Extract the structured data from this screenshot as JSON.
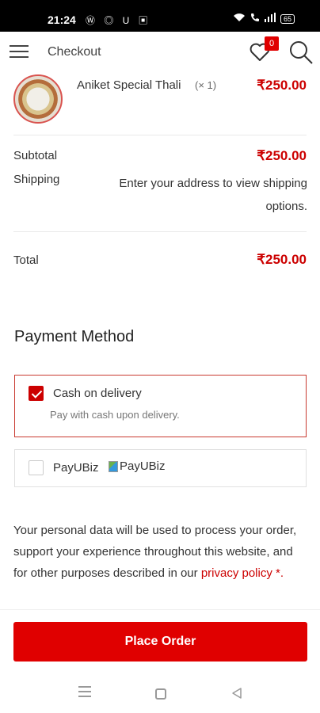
{
  "status_bar": {
    "time": "21:24",
    "left_icons": "Ⓦ ◎ U ▣",
    "battery": "65"
  },
  "header": {
    "title": "Checkout",
    "wishlist_count": "0"
  },
  "order": {
    "item_name": "Aniket Special Thali",
    "item_qty": "(× 1)",
    "item_price": "₹250.00",
    "subtotal_label": "Subtotal",
    "subtotal_value": "₹250.00",
    "shipping_label": "Shipping",
    "shipping_text": "Enter your address to view shipping options.",
    "total_label": "Total",
    "total_value": "₹250.00"
  },
  "payment": {
    "title": "Payment Method",
    "methods": [
      {
        "label": "Cash on delivery",
        "description": "Pay with cash upon delivery.",
        "selected": true
      },
      {
        "label": "PayUBiz",
        "image_alt": "PayUBiz",
        "selected": false
      }
    ]
  },
  "privacy": {
    "text": "Your personal data will be used to process your order, support your experience throughout this website, and for other purposes described in our",
    "link": "privacy policy",
    "suffix": " *."
  },
  "actions": {
    "place_order": "Place Order"
  },
  "colors": {
    "accent": "#e00000",
    "price": "#cc0000"
  }
}
